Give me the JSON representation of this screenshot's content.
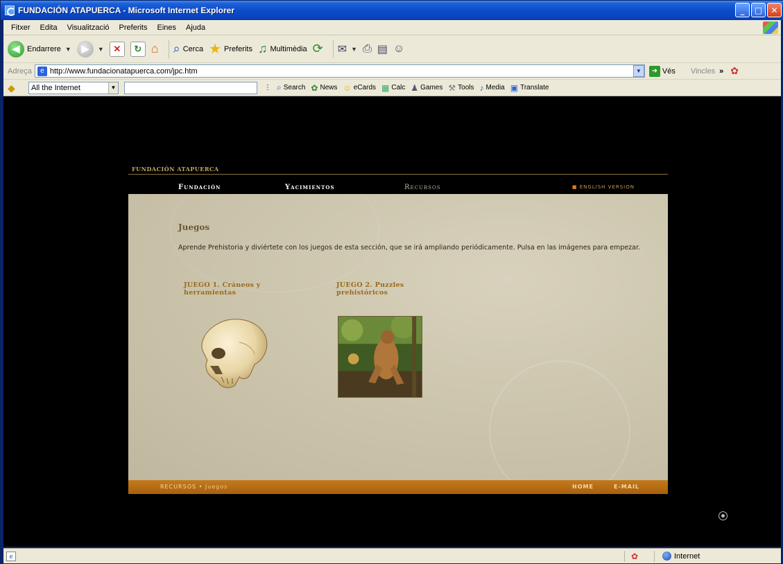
{
  "window": {
    "title": "FUNDACIÓN ATAPUERCA - Microsoft Internet Explorer"
  },
  "menu": [
    "Fitxer",
    "Edita",
    "Visualització",
    "Preferits",
    "Eines",
    "Ajuda"
  ],
  "toolbar": {
    "back_label": "Endarrere",
    "search_label": "Cerca",
    "favorites_label": "Preferits",
    "media_label": "Multimèdia"
  },
  "address": {
    "label": "Adreça",
    "url": "http://www.fundacionatapuerca.com/jpc.htm",
    "go_label": "Vés",
    "links_label": "Vincles"
  },
  "links_toolbar": {
    "scope": "All the Internet",
    "items": [
      {
        "icon": "search-icon",
        "label": "Search"
      },
      {
        "icon": "news-icon",
        "label": "News"
      },
      {
        "icon": "smiley-icon",
        "label": "eCards"
      },
      {
        "icon": "calc-icon",
        "label": "Calc"
      },
      {
        "icon": "games-icon",
        "label": "Games"
      },
      {
        "icon": "tools-icon",
        "label": "Tools"
      },
      {
        "icon": "media-icon",
        "label": "Media"
      },
      {
        "icon": "translate-icon",
        "label": "Translate"
      }
    ]
  },
  "site": {
    "brand": "FUNDACIÓN ATAPUERCA",
    "nav": [
      "Fundación",
      "Yacimientos",
      "Recursos"
    ],
    "english": "ENGLISH VERSION",
    "title": "Juegos",
    "intro": "Aprende Prehistoria y diviértete con los juegos de esta sección, que se irá ampliando periódicamente. Pulsa en las imágenes para empezar.",
    "games": [
      {
        "title": "JUEGO 1. Cráneos y herramientas"
      },
      {
        "title": "JUEGO 2. Puzzles prehistóricos"
      }
    ],
    "breadcrumb_section": "RECURSOS",
    "breadcrumb_page": "Juegos",
    "footer_home": "HOME",
    "footer_email": "E-MAIL"
  },
  "status": {
    "zone": "Internet"
  },
  "colors": {
    "panel_bg": "#cdc6ae",
    "footer_bar": "#b86c14",
    "title_gold": "#9a6a1a",
    "brand_gold": "#c4a865"
  }
}
